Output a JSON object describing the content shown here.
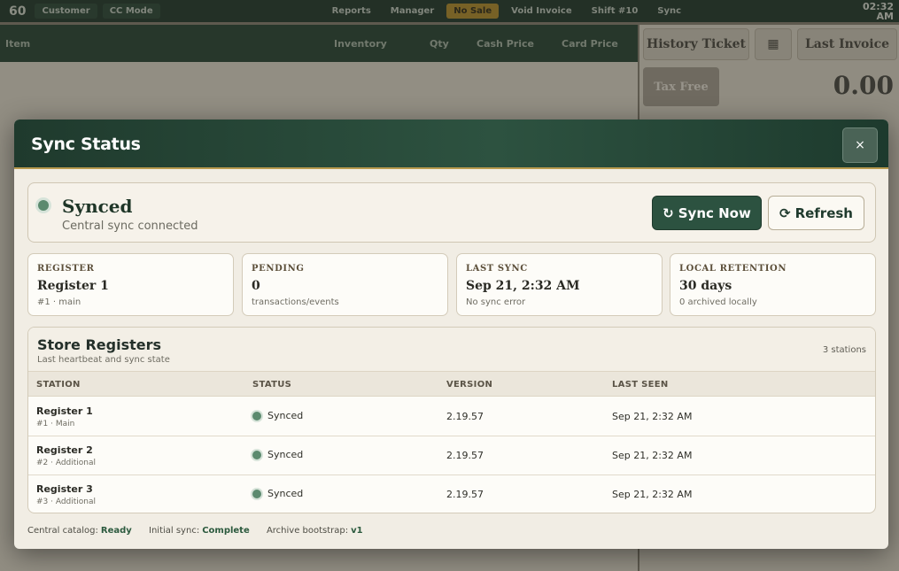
{
  "background": {
    "topbar": {
      "register_number": "60",
      "buttons": [
        "Customer",
        "CC Mode"
      ],
      "right_items": [
        "Reports",
        "Manager",
        "No Sale",
        "Void Invoice",
        "Shift #10",
        "Sync"
      ],
      "clock": [
        "02:32",
        "AM"
      ]
    },
    "columns": [
      "Item",
      "Inventory",
      "Qty",
      "Cash Price",
      "Card Price"
    ],
    "right_panel": {
      "history_ticket": "History Ticket",
      "last_invoice": "Last Invoice",
      "tax_free": "Tax Free",
      "total": "0.00"
    }
  },
  "modal": {
    "title": "Sync Status",
    "close_label": "×",
    "status": {
      "title": "Synced",
      "subtitle": "Central sync connected",
      "sync_now_label": "Sync Now",
      "refresh_label": "Refresh"
    },
    "cards": [
      {
        "label": "REGISTER",
        "value": "Register 1",
        "sub": "#1 · main"
      },
      {
        "label": "PENDING",
        "value": "0",
        "sub": "transactions/events"
      },
      {
        "label": "LAST SYNC",
        "value": "Sep 21, 2:32 AM",
        "sub": "No sync error"
      },
      {
        "label": "LOCAL RETENTION",
        "value": "30 days",
        "sub": "0 archived locally"
      }
    ],
    "registers": {
      "title": "Store Registers",
      "subtitle": "Last heartbeat and sync state",
      "count": "3 stations",
      "columns": [
        "STATION",
        "STATUS",
        "VERSION",
        "LAST SEEN"
      ],
      "rows": [
        {
          "name": "Register 1",
          "sub": "#1 · Main",
          "status": "Synced",
          "version": "2.19.57",
          "last_seen": "Sep 21, 2:32 AM"
        },
        {
          "name": "Register 2",
          "sub": "#2 · Additional",
          "status": "Synced",
          "version": "2.19.57",
          "last_seen": "Sep 21, 2:32 AM"
        },
        {
          "name": "Register 3",
          "sub": "#3 · Additional",
          "status": "Synced",
          "version": "2.19.57",
          "last_seen": "Sep 21, 2:32 AM"
        }
      ]
    },
    "footer": {
      "catalog_label": "Central catalog:",
      "catalog_value": "Ready",
      "initial_label": "Initial sync:",
      "initial_value": "Complete",
      "archive_label": "Archive bootstrap:",
      "archive_value": "v1"
    }
  },
  "colors": {
    "header_green": "#1f3a2d",
    "accent_gold": "#b89a4e",
    "synced_dot": "#5b8a6e",
    "modal_bg": "#f1ede4"
  }
}
